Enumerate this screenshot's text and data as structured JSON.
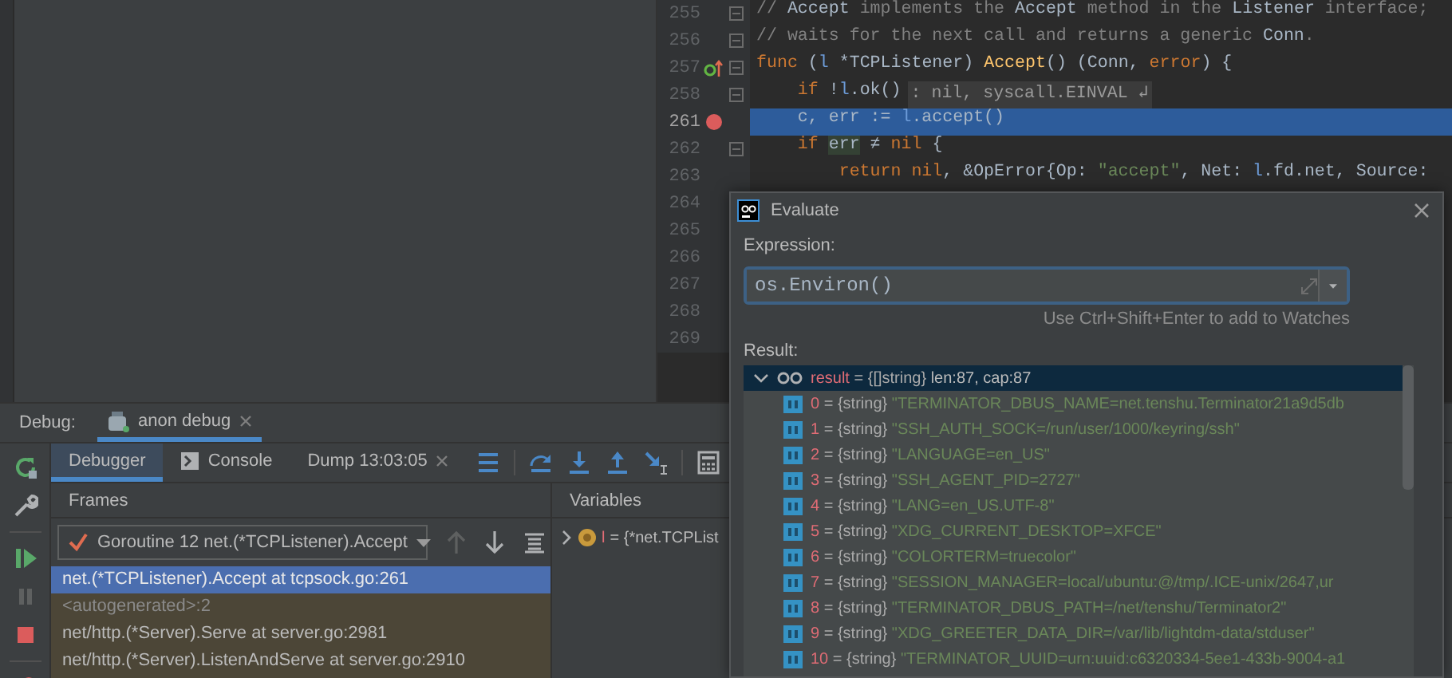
{
  "editor": {
    "lines": [
      {
        "number": "255",
        "fold": true,
        "current": false,
        "tokens": [
          {
            "kind": "comment",
            "text": "// "
          },
          {
            "kind": "ref",
            "text": "Accept"
          },
          {
            "kind": "comment",
            "text": " implements the "
          },
          {
            "kind": "ref",
            "text": "Accept"
          },
          {
            "kind": "comment",
            "text": " method in the "
          },
          {
            "kind": "ref",
            "text": "Listener"
          },
          {
            "kind": "comment",
            "text": " interface;"
          }
        ]
      },
      {
        "number": "256",
        "fold": true,
        "current": false,
        "tokens": [
          {
            "kind": "comment",
            "text": "// waits for the next call and returns a generic "
          },
          {
            "kind": "ref",
            "text": "Conn"
          },
          {
            "kind": "comment",
            "text": "."
          }
        ]
      },
      {
        "number": "257",
        "gutter_icon": {
          "kind": "implements"
        },
        "fold": true,
        "current": false,
        "tokens": [
          {
            "kind": "keyword",
            "text": "func"
          },
          {
            "kind": "plain",
            "text": " ("
          },
          {
            "kind": "param",
            "text": "l"
          },
          {
            "kind": "plain",
            "text": " *"
          },
          {
            "kind": "type",
            "text": "TCPListener"
          },
          {
            "kind": "plain",
            "text": ") "
          },
          {
            "kind": "func",
            "text": "Accept"
          },
          {
            "kind": "plain",
            "text": "() ("
          },
          {
            "kind": "type",
            "text": "Conn"
          },
          {
            "kind": "plain",
            "text": ", "
          },
          {
            "kind": "keyword",
            "text": "error"
          },
          {
            "kind": "plain",
            "text": ") {"
          }
        ]
      },
      {
        "number": "258",
        "fold": true,
        "current": false,
        "tokens": [
          {
            "kind": "keyword",
            "text": "    if"
          },
          {
            "kind": "plain",
            "text": " !"
          },
          {
            "kind": "param",
            "text": "l"
          },
          {
            "kind": "plain",
            "text": ".ok()"
          }
        ],
        "fold_hint": ": nil, syscall.EINVAL ↲"
      },
      {
        "number": "261",
        "gutter_icon": {
          "kind": "breakpoint"
        },
        "current": true,
        "tokens": [
          {
            "kind": "plain",
            "text": "    c, err := "
          },
          {
            "kind": "param",
            "text": "l"
          },
          {
            "kind": "plain",
            "text": ".accept()"
          }
        ]
      },
      {
        "number": "262",
        "fold": true,
        "current": false,
        "tokens": [
          {
            "kind": "keyword",
            "text": "    if "
          },
          {
            "kind": "usage",
            "text": "err"
          },
          {
            "kind": "plain",
            "text": " ≠ "
          },
          {
            "kind": "keyword",
            "text": "nil"
          },
          {
            "kind": "plain",
            "text": " {"
          }
        ]
      },
      {
        "number": "263",
        "current": false,
        "tokens": [
          {
            "kind": "keyword",
            "text": "        return nil"
          },
          {
            "kind": "plain",
            "text": ", &OpError{Op: "
          },
          {
            "kind": "string",
            "text": "\"accept\""
          },
          {
            "kind": "plain",
            "text": ", Net: "
          },
          {
            "kind": "param",
            "text": "l"
          },
          {
            "kind": "plain",
            "text": ".fd.net, Source:"
          }
        ]
      },
      {
        "number": "264",
        "current": false
      },
      {
        "number": "265",
        "current": false
      },
      {
        "number": "266",
        "current": false
      },
      {
        "number": "267",
        "current": false
      },
      {
        "number": "268",
        "current": false
      },
      {
        "number": "269",
        "current": false
      }
    ]
  },
  "debug": {
    "label": "Debug:",
    "session": "anon debug",
    "tabs": [
      {
        "label": "Debugger",
        "kind": "plain",
        "selected": true,
        "closable": false
      },
      {
        "label": "Console",
        "kind": "console",
        "selected": false,
        "closable": false
      },
      {
        "label": "Dump 13:03:05",
        "kind": "plain",
        "selected": false,
        "closable": true
      }
    ],
    "frames": {
      "title": "Frames",
      "thread": "Goroutine 12 net.(*TCPListener).Accept",
      "items": [
        {
          "text": "net.(*TCPListener).Accept at tcpsock.go:261",
          "selected": true,
          "dimmed": false
        },
        {
          "text": "<autogenerated>:2",
          "selected": false,
          "dimmed": true
        },
        {
          "text": "net/http.(*Server).Serve at server.go:2981",
          "selected": false,
          "dimmed": false
        },
        {
          "text": "net/http.(*Server).ListenAndServe at server.go:2910",
          "selected": false,
          "dimmed": false
        }
      ]
    },
    "variables": {
      "title": "Variables",
      "items": [
        {
          "name": "l",
          "value": "= {*net.TCPList"
        }
      ]
    }
  },
  "evaluate": {
    "title": "Evaluate",
    "expression_label": "Expression:",
    "expression": "os.Environ()",
    "hint": "Use Ctrl+Shift+Enter to add to Watches",
    "result_label": "Result:",
    "result": {
      "name": "result",
      "type": "= {[]string}",
      "summary": "len:87, cap:87",
      "expanded": true,
      "selected": true,
      "children": [
        {
          "index": "0",
          "type": "= {string}",
          "value": "\"TERMINATOR_DBUS_NAME=net.tenshu.Terminator21a9d5db"
        },
        {
          "index": "1",
          "type": "= {string}",
          "value": "\"SSH_AUTH_SOCK=/run/user/1000/keyring/ssh\""
        },
        {
          "index": "2",
          "type": "= {string}",
          "value": "\"LANGUAGE=en_US\""
        },
        {
          "index": "3",
          "type": "= {string}",
          "value": "\"SSH_AGENT_PID=2727\""
        },
        {
          "index": "4",
          "type": "= {string}",
          "value": "\"LANG=en_US.UTF-8\""
        },
        {
          "index": "5",
          "type": "= {string}",
          "value": "\"XDG_CURRENT_DESKTOP=XFCE\""
        },
        {
          "index": "6",
          "type": "= {string}",
          "value": "\"COLORTERM=truecolor\""
        },
        {
          "index": "7",
          "type": "= {string}",
          "value": "\"SESSION_MANAGER=local/ubuntu:@/tmp/.ICE-unix/2647,ur"
        },
        {
          "index": "8",
          "type": "= {string}",
          "value": "\"TERMINATOR_DBUS_PATH=/net/tenshu/Terminator2\""
        },
        {
          "index": "9",
          "type": "= {string}",
          "value": "\"XDG_GREETER_DATA_DIR=/var/lib/lightdm-data/stduser\""
        },
        {
          "index": "10",
          "type": "= {string}",
          "value": "\"TERMINATOR_UUID=urn:uuid:c6320334-5ee1-433b-9004-a1"
        }
      ]
    }
  }
}
